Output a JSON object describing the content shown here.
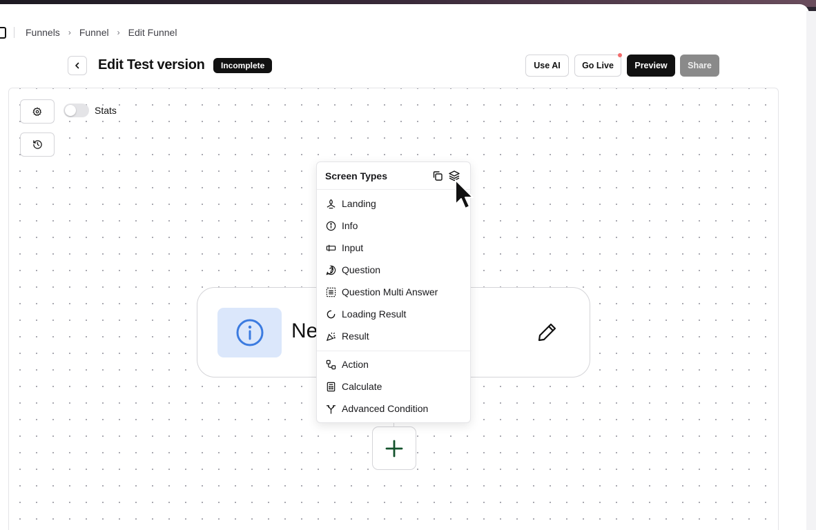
{
  "breadcrumb": [
    "Funnels",
    "Funnel",
    "Edit Funnel"
  ],
  "header": {
    "title": "Edit Test version",
    "status_badge": "Incomplete",
    "buttons": {
      "use_ai": "Use AI",
      "go_live": "Go Live",
      "preview": "Preview",
      "share": "Share"
    }
  },
  "canvas": {
    "stats_label": "Stats",
    "stats_enabled": false,
    "node": {
      "title": "Ne"
    }
  },
  "menu": {
    "title": "Screen Types",
    "items": [
      {
        "label": "Landing",
        "icon": "landing-icon"
      },
      {
        "label": "Info",
        "icon": "info-icon"
      },
      {
        "label": "Input",
        "icon": "input-icon"
      },
      {
        "label": "Question",
        "icon": "question-icon"
      },
      {
        "label": "Question Multi Answer",
        "icon": "multi-answer-icon"
      },
      {
        "label": "Loading Result",
        "icon": "loading-icon"
      },
      {
        "label": "Result",
        "icon": "party-popper-icon"
      },
      {
        "label": "Action",
        "icon": "action-icon"
      },
      {
        "label": "Calculate",
        "icon": "calculator-icon"
      },
      {
        "label": "Advanced Condition",
        "icon": "split-icon"
      }
    ]
  },
  "colors": {
    "accent_dark": "#111111",
    "info_blue": "#3b82f6",
    "node_icon_bg": "#dbe7fb",
    "add_green": "#14532d",
    "live_dot": "#f26b6b"
  }
}
